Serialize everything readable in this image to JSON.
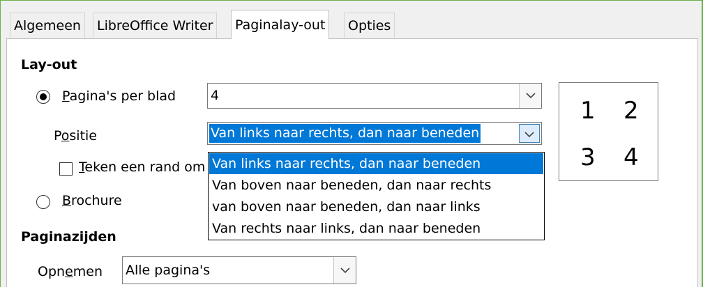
{
  "tabs": [
    {
      "label": "Algemeen"
    },
    {
      "label": "LibreOffice Writer"
    },
    {
      "label": "Paginalay-out"
    },
    {
      "label": "Opties"
    }
  ],
  "layout": {
    "section_title": "Lay-out",
    "pages_per_sheet": {
      "label_mnemonic": "P",
      "label_rest": "agina's per blad",
      "value": "4",
      "selected": true
    },
    "position": {
      "label_pre": "P",
      "label_mnemonic": "o",
      "label_rest": "sitie",
      "value": "Van links naar rechts, dan naar beneden",
      "options": [
        "Van links naar rechts, dan naar beneden",
        "Van boven naar beneden, dan naar rechts",
        "van boven naar beneden, dan naar links",
        "Van rechts naar links, dan naar beneden"
      ],
      "selected_index": 0
    },
    "draw_border": {
      "label_mnemonic": "T",
      "label_rest": "eken een rand om",
      "checked": false
    },
    "brochure": {
      "label_mnemonic": "B",
      "label_rest": "rochure",
      "selected": false
    },
    "preview_numbers": [
      "1",
      "2",
      "3",
      "4"
    ]
  },
  "page_sides": {
    "section_title": "Paginazijden",
    "include": {
      "label_pre": "Opn",
      "label_mnemonic": "e",
      "label_rest": "men",
      "value": "Alle pagina's"
    }
  },
  "icons": {
    "combo_arrow": "chevron-down-icon"
  },
  "colors": {
    "selection": "#0078d7",
    "window_border": "#6ab04c"
  }
}
